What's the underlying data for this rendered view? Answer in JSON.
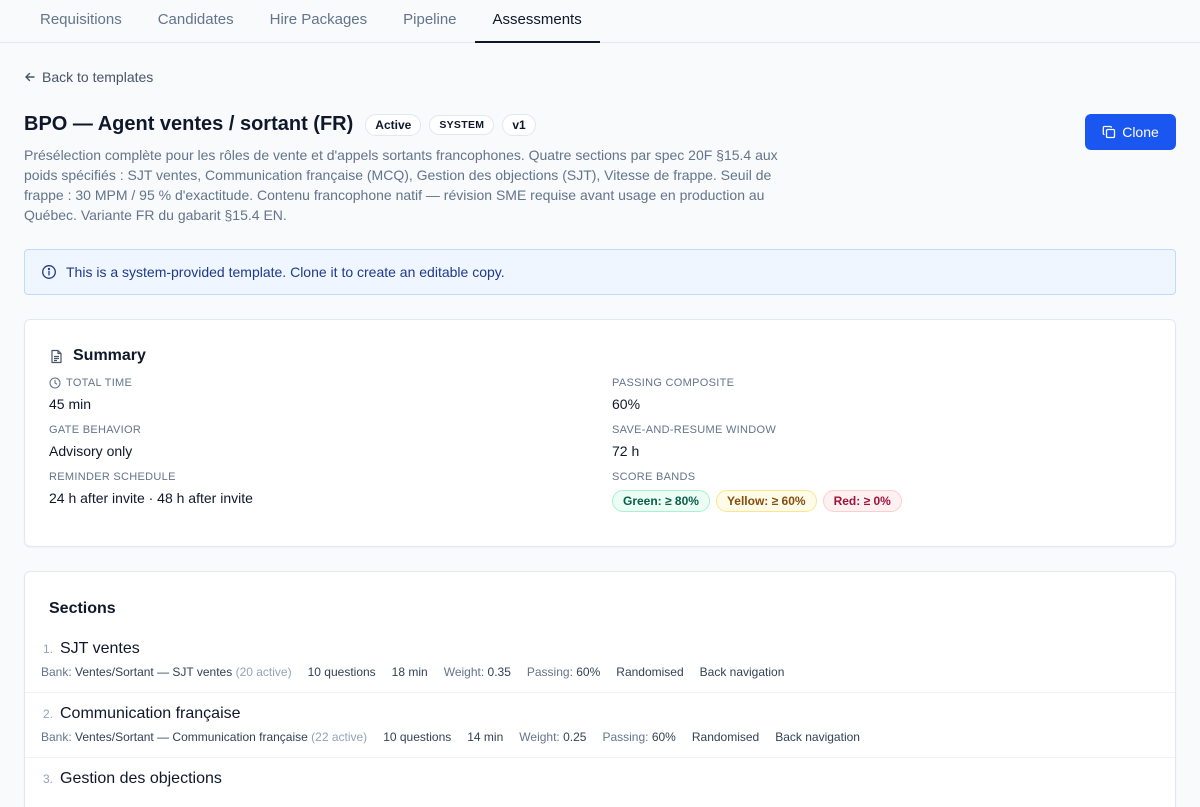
{
  "nav": {
    "tabs": [
      {
        "label": "Requisitions"
      },
      {
        "label": "Candidates"
      },
      {
        "label": "Hire Packages"
      },
      {
        "label": "Pipeline"
      },
      {
        "label": "Assessments"
      }
    ],
    "active_index": 4
  },
  "back_link": "Back to templates",
  "template": {
    "title": "BPO — Agent ventes / sortant (FR)",
    "badges": [
      "Active",
      "SYSTEM",
      "v1"
    ],
    "description": "Présélection complète pour les rôles de vente et d'appels sortants francophones. Quatre sections par spec 20F §15.4 aux poids spécifiés : SJT ventes, Communication française (MCQ), Gestion des objections (SJT), Vitesse de frappe. Seuil de frappe : 30 MPM / 95 % d'exactitude. Contenu francophone natif — révision SME requise avant usage en production au Québec. Variante FR du gabarit §15.4 EN.",
    "clone_label": "Clone"
  },
  "info_banner": "This is a system-provided template. Clone it to create an editable copy.",
  "summary": {
    "title": "Summary",
    "total_time_label": "TOTAL TIME",
    "total_time": "45 min",
    "passing_composite_label": "PASSING COMPOSITE",
    "passing_composite": "60%",
    "gate_behavior_label": "GATE BEHAVIOR",
    "gate_behavior": "Advisory only",
    "save_resume_label": "SAVE-AND-RESUME WINDOW",
    "save_resume": "72 h",
    "reminder_label": "REMINDER SCHEDULE",
    "reminder": "24 h after invite · 48 h after invite",
    "score_bands_label": "SCORE BANDS",
    "bands": {
      "green": "Green: ≥ 80%",
      "yellow": "Yellow: ≥ 60%",
      "red": "Red: ≥ 0%"
    }
  },
  "sections": {
    "title": "Sections",
    "items": [
      {
        "num": "1.",
        "name": "SJT ventes",
        "bank_label": "Bank:",
        "bank": "Ventes/Sortant — SJT ventes",
        "bank_active": "(20 active)",
        "questions": "10 questions",
        "time": "18 min",
        "weight_label": "Weight:",
        "weight": "0.35",
        "passing_label": "Passing:",
        "passing": "60%",
        "randomised": "Randomised",
        "back_nav": "Back navigation"
      },
      {
        "num": "2.",
        "name": "Communication française",
        "bank_label": "Bank:",
        "bank": "Ventes/Sortant — Communication française",
        "bank_active": "(22 active)",
        "questions": "10 questions",
        "time": "14 min",
        "weight_label": "Weight:",
        "weight": "0.25",
        "passing_label": "Passing:",
        "passing": "60%",
        "randomised": "Randomised",
        "back_nav": "Back navigation"
      },
      {
        "num": "3.",
        "name": "Gestion des objections"
      }
    ]
  }
}
